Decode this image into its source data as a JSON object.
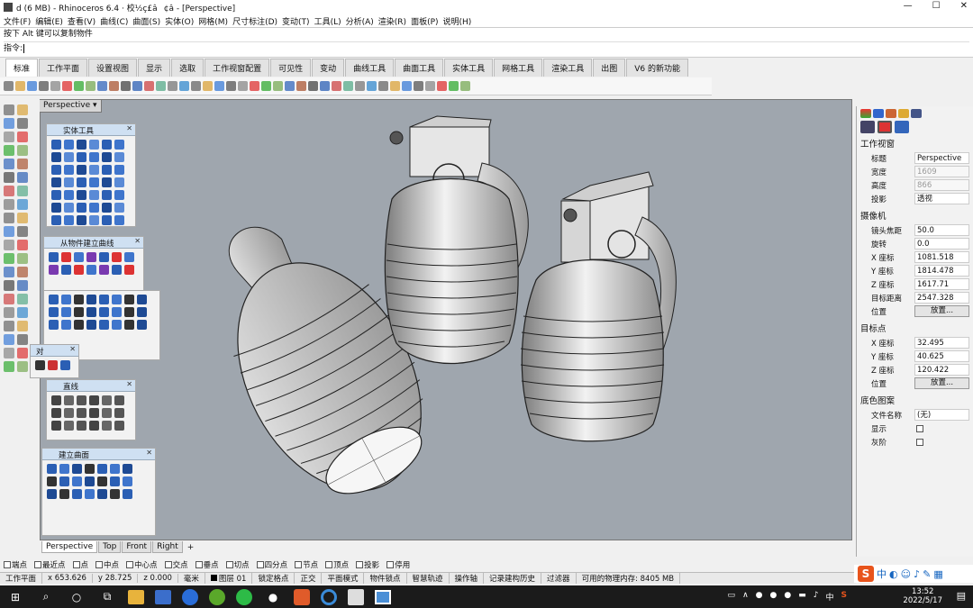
{
  "window": {
    "title": "d (6 MB) - Rhinoceros 6.4 · 校½ç£â¢â - [Perspective]",
    "minimize": "—",
    "maximize": "☐",
    "close": "✕"
  },
  "menu": [
    "文件(F)",
    "编辑(E)",
    "查看(V)",
    "曲线(C)",
    "曲面(S)",
    "实体(O)",
    "网格(M)",
    "尺寸标注(D)",
    "变动(T)",
    "工具(L)",
    "分析(A)",
    "渲染(R)",
    "面板(P)",
    "说明(H)"
  ],
  "history": {
    "line1": "按下 Alt 键可以复制物件",
    "prompt": "指令:"
  },
  "tabs": [
    "标准",
    "工作平面",
    "设置视图",
    "显示",
    "选取",
    "工作视窗配置",
    "可见性",
    "变动",
    "曲线工具",
    "曲面工具",
    "实体工具",
    "网格工具",
    "渲染工具",
    "出图",
    "V6 的新功能"
  ],
  "viewport": {
    "label": "Perspective",
    "tabs": [
      "Perspective",
      "Top",
      "Front",
      "Right"
    ],
    "add": "+"
  },
  "panels": {
    "solid_tools": "实体工具",
    "from_objects": "从物件建立曲线",
    "curves": "直线",
    "build_surface": "建立曲面",
    "snippet": "对"
  },
  "osnap": [
    "端点",
    "最近点",
    "点",
    "中点",
    "中心点",
    "交点",
    "垂点",
    "切点",
    "四分点",
    "节点",
    "顶点",
    "投影",
    "停用"
  ],
  "status": {
    "plane": "工作平面",
    "x": "x 653.626",
    "y": "y 28.725",
    "z": "z 0.000",
    "units": "毫米",
    "layer": "图层 01",
    "grid_snap": "锁定格点",
    "ortho": "正交",
    "planar": "平面模式",
    "osnap": "物件锁点",
    "smart": "智慧轨迹",
    "gumball": "操作轴",
    "history": "记录建构历史",
    "filter": "过滤器",
    "memory": "可用的物理内存: 8405 MB"
  },
  "properties": {
    "section_view": "工作视窗",
    "rows_view": [
      {
        "k": "标题",
        "v": "Perspective",
        "dim": false
      },
      {
        "k": "宽度",
        "v": "1609",
        "dim": true
      },
      {
        "k": "高度",
        "v": "866",
        "dim": true
      },
      {
        "k": "投影",
        "v": "透视",
        "dim": false
      }
    ],
    "section_camera": "摄像机",
    "rows_camera": [
      {
        "k": "镜头焦距",
        "v": "50.0"
      },
      {
        "k": "旋转",
        "v": "0.0"
      },
      {
        "k": "X 座标",
        "v": "1081.518"
      },
      {
        "k": "Y 座标",
        "v": "1814.478"
      },
      {
        "k": "Z 座标",
        "v": "1617.71"
      },
      {
        "k": "目标距离",
        "v": "2547.328"
      }
    ],
    "pos_label": "位置",
    "place_btn": "放置...",
    "section_target": "目标点",
    "rows_target": [
      {
        "k": "X 座标",
        "v": "32.495"
      },
      {
        "k": "Y 座标",
        "v": "40.625"
      },
      {
        "k": "Z 座标",
        "v": "120.422"
      }
    ],
    "section_wallpaper": "底色图案",
    "file_name_label": "文件名称",
    "file_name_value": "(无)",
    "show_label": "显示",
    "gray_label": "灰阶"
  },
  "ime": {
    "logo": "S",
    "lang": "中"
  },
  "taskbar": {
    "time": "13:52",
    "date": "2022/5/17",
    "lang": "中",
    "s_icon": "S"
  },
  "colors": {
    "viewport_bg": "#9fa6ae",
    "panel_header": "#cfe0f2",
    "taskbar": "#1b1b1b",
    "accent_icon": "#2b5fb4"
  }
}
